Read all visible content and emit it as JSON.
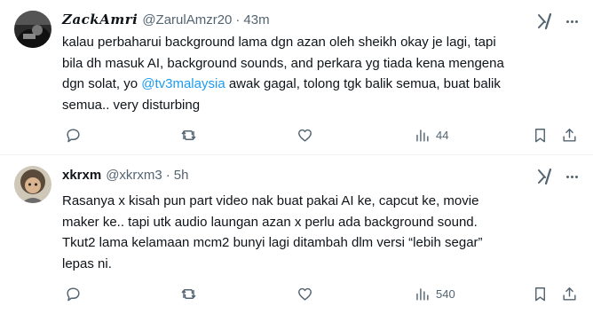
{
  "tweets": [
    {
      "display_name": "𝒁𝒂𝒄𝒌𝑨𝒎𝒓𝒊",
      "handle": "@ZarulAmzr20",
      "separator": "·",
      "time": "43m",
      "lines": [
        "kalau perbaharui background lama dgn azan oleh sheikh okay je lagi, tapi",
        "bila dh masuk AI, background sounds, and perkara yg tiada kena mengena"
      ],
      "line3_before": "dgn solat, yo ",
      "mention": "@tv3malaysia",
      "line3_after": " awak gagal, tolong tgk balik semua, buat balik",
      "line4": "semua.. very disturbing",
      "replies": "",
      "retweets": "",
      "likes": "",
      "views": "44"
    },
    {
      "display_name": "xkrxm",
      "handle": "@xkrxm3",
      "separator": "·",
      "time": "5h",
      "lines": [
        "Rasanya x kisah pun part video nak buat pakai AI ke, capcut ke, movie",
        "maker ke.. tapi utk audio laungan azan x perlu ada background sound.",
        "Tkut2 lama kelamaan mcm2 bunyi lagi ditambah dlm versi “lebih segar”",
        "lepas ni."
      ],
      "replies": "",
      "retweets": "",
      "likes": "",
      "views": "540"
    }
  ],
  "colors": {
    "text": "#0f1419",
    "secondary": "#536471",
    "link": "#1d9bf0",
    "divider": "#eff3f4"
  },
  "icons": [
    "reply-icon",
    "retweet-icon",
    "like-icon",
    "views-icon",
    "bookmark-icon",
    "share-icon",
    "grok-icon",
    "more-icon"
  ]
}
